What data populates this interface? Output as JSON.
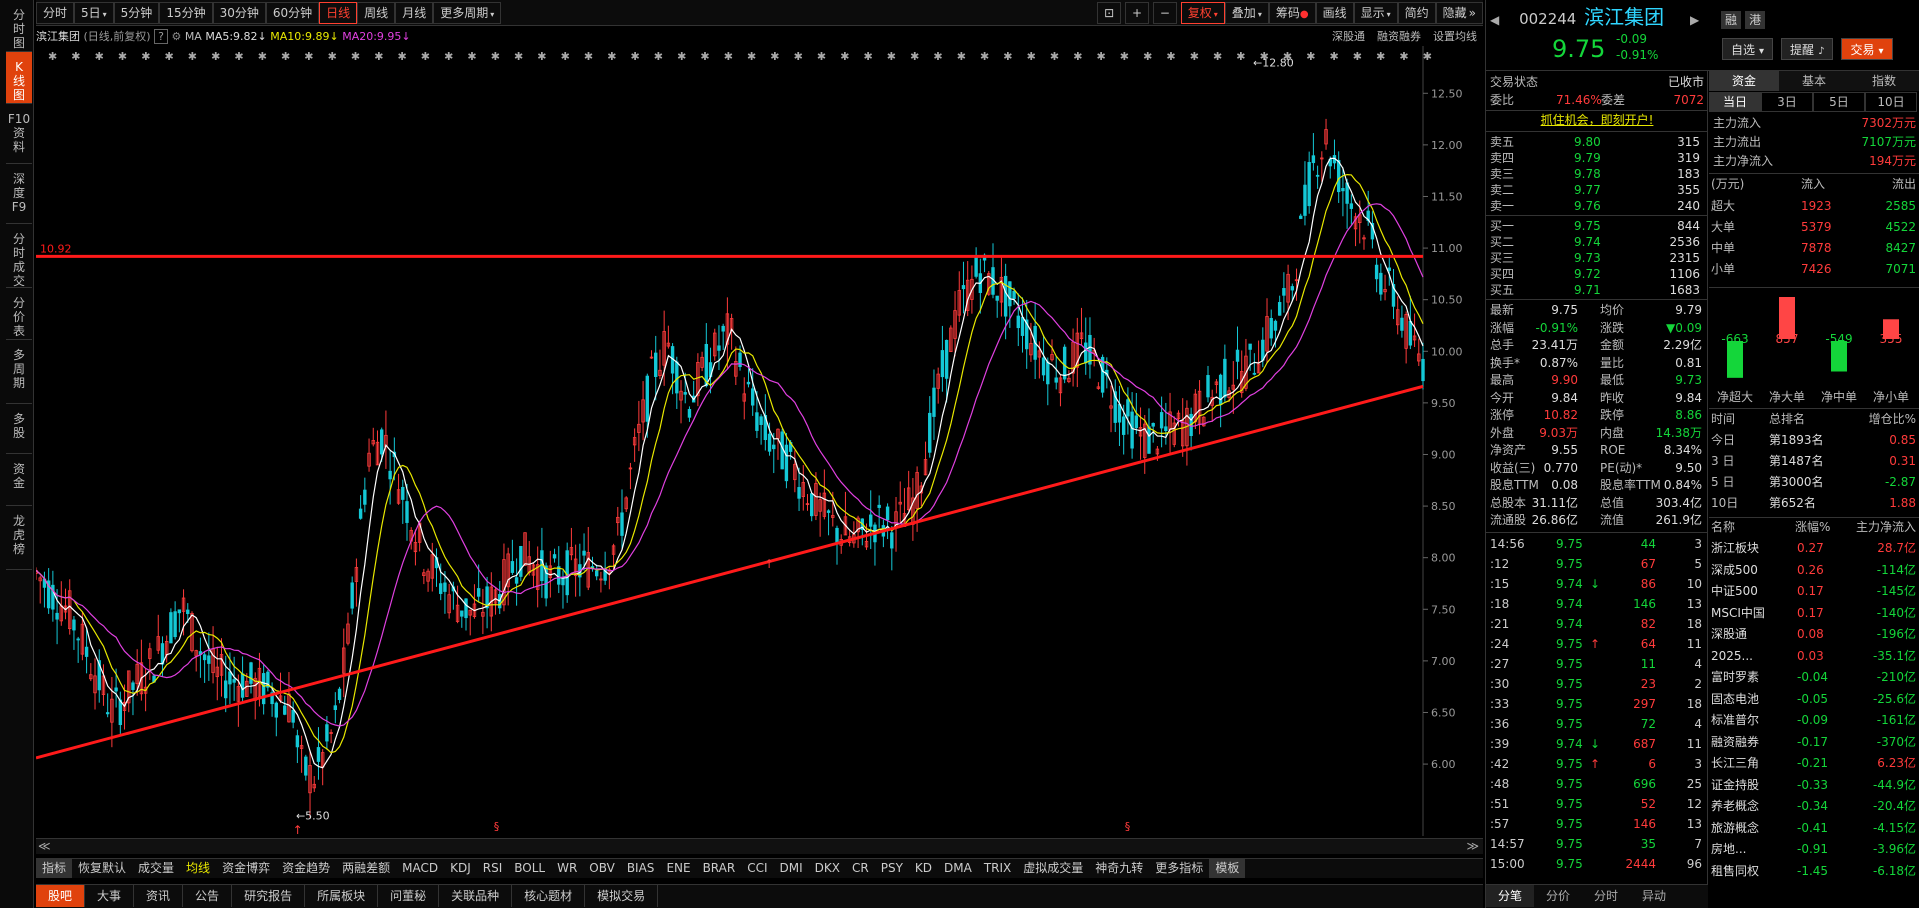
{
  "left_tabs": [
    {
      "label": "分\n时\n图",
      "active": false
    },
    {
      "label": "K\n线\n图",
      "active": true
    },
    {
      "label": "F10\n资\n料",
      "active": false
    },
    {
      "label": "深\n度\nF9",
      "active": false
    },
    {
      "label": "分\n时\n成\n交",
      "active": false
    },
    {
      "label": "分\n价\n表",
      "active": false
    },
    {
      "label": "多\n周\n期",
      "active": false
    },
    {
      "label": "多\n股",
      "active": false
    },
    {
      "label": "资\n金",
      "active": false
    },
    {
      "label": "龙\n虎\n榜",
      "active": false
    }
  ],
  "toolbar": {
    "periods": [
      "分时",
      "5日",
      "5分钟",
      "15分钟",
      "30分钟",
      "60分钟",
      "日线",
      "周线",
      "月线",
      "更多周期"
    ],
    "active_period": "日线",
    "right_buttons": [
      "复权",
      "叠加",
      "筹码",
      "画线",
      "显示",
      "简约",
      "隐藏"
    ],
    "active_right": "复权"
  },
  "info": {
    "name": "滨江集团",
    "mode": "(日线,前复权)",
    "help": "?",
    "ma_label": "MA",
    "ma5": "MA5:9.82",
    "ma10": "MA10:9.89",
    "ma20": "MA20:9.95",
    "right_links": [
      "深股通",
      "融资融券",
      "设置均线"
    ]
  },
  "colors": {
    "ma5": "#ffffff",
    "ma10": "#e8e800",
    "ma20": "#e040e0",
    "up": "#ff3b3b",
    "down": "#14c8d6",
    "line": "#ff1a1a"
  },
  "chart_data": {
    "type": "candlestick",
    "y_ticks": [
      "12.50",
      "12.00",
      "11.50",
      "11.00",
      "10.50",
      "10.00",
      "9.50",
      "9.00",
      "8.50",
      "8.00",
      "7.50",
      "7.00",
      "6.50",
      "6.00"
    ],
    "ylim": [
      5.4,
      12.9
    ],
    "hline": {
      "value": 10.92,
      "label": "10.92"
    },
    "trendline": {
      "from": [
        0,
        6.06
      ],
      "to": [
        1,
        9.66
      ]
    },
    "annotations": [
      {
        "text": "12.80",
        "x": 0.876,
        "y": 12.8
      },
      {
        "text": "5.50",
        "x": 0.186,
        "y": 5.5
      }
    ],
    "markers": [
      "§",
      "§"
    ],
    "keypoints": [
      [
        0.0,
        7.85
      ],
      [
        0.025,
        7.45
      ],
      [
        0.055,
        6.5
      ],
      [
        0.07,
        6.75
      ],
      [
        0.085,
        7.0
      ],
      [
        0.105,
        7.55
      ],
      [
        0.115,
        7.2
      ],
      [
        0.13,
        6.85
      ],
      [
        0.15,
        6.8
      ],
      [
        0.17,
        6.7
      ],
      [
        0.185,
        6.55
      ],
      [
        0.19,
        6.0
      ],
      [
        0.2,
        5.85
      ],
      [
        0.215,
        6.35
      ],
      [
        0.225,
        7.2
      ],
      [
        0.232,
        8.1
      ],
      [
        0.24,
        9.0
      ],
      [
        0.25,
        9.2
      ],
      [
        0.265,
        8.6
      ],
      [
        0.28,
        8.0
      ],
      [
        0.3,
        7.6
      ],
      [
        0.315,
        7.45
      ],
      [
        0.33,
        7.6
      ],
      [
        0.35,
        8.05
      ],
      [
        0.37,
        7.8
      ],
      [
        0.39,
        7.9
      ],
      [
        0.41,
        7.95
      ],
      [
        0.42,
        8.2
      ],
      [
        0.43,
        8.9
      ],
      [
        0.445,
        9.8
      ],
      [
        0.455,
        10.1
      ],
      [
        0.47,
        9.5
      ],
      [
        0.485,
        9.9
      ],
      [
        0.5,
        10.2
      ],
      [
        0.51,
        9.7
      ],
      [
        0.525,
        9.2
      ],
      [
        0.545,
        8.9
      ],
      [
        0.56,
        8.55
      ],
      [
        0.575,
        8.3
      ],
      [
        0.59,
        8.15
      ],
      [
        0.605,
        8.35
      ],
      [
        0.62,
        8.3
      ],
      [
        0.635,
        8.6
      ],
      [
        0.65,
        9.6
      ],
      [
        0.665,
        10.4
      ],
      [
        0.68,
        10.8
      ],
      [
        0.695,
        10.6
      ],
      [
        0.71,
        10.3
      ],
      [
        0.725,
        9.95
      ],
      [
        0.74,
        9.8
      ],
      [
        0.755,
        10.05
      ],
      [
        0.77,
        9.75
      ],
      [
        0.785,
        9.35
      ],
      [
        0.8,
        9.15
      ],
      [
        0.815,
        9.2
      ],
      [
        0.83,
        9.3
      ],
      [
        0.845,
        9.55
      ],
      [
        0.86,
        9.75
      ],
      [
        0.875,
        9.85
      ],
      [
        0.89,
        10.2
      ],
      [
        0.905,
        10.6
      ],
      [
        0.92,
        11.8
      ],
      [
        0.93,
        12.05
      ],
      [
        0.945,
        11.5
      ],
      [
        0.96,
        11.2
      ],
      [
        0.97,
        10.7
      ],
      [
        0.98,
        10.5
      ],
      [
        0.99,
        10.1
      ],
      [
        1.0,
        9.9
      ]
    ]
  },
  "bottom_scroll": {
    "left": "≪",
    "right": "≫"
  },
  "indicators": [
    "指标",
    "恢复默认",
    "成交量",
    "均线",
    "资金博弈",
    "资金趋势",
    "两融差额",
    "MACD",
    "KDJ",
    "RSI",
    "BOLL",
    "WR",
    "OBV",
    "BIAS",
    "ENE",
    "BRAR",
    "CCI",
    "DMI",
    "DKX",
    "CR",
    "PSY",
    "KD",
    "DMA",
    "TRIX",
    "虚拟成交量",
    "神奇九转",
    "更多指标",
    "模板"
  ],
  "active_indicator": "均线",
  "bottom_tabs": [
    "股吧",
    "大事",
    "资讯",
    "公告",
    "研究报告",
    "所属板块",
    "问董秘",
    "关联品种",
    "核心题材",
    "模拟交易"
  ],
  "active_bottom": "股吧",
  "quote": {
    "code": "002244",
    "name": "滨江集团",
    "badges": [
      "融",
      "港"
    ],
    "price": "9.75",
    "change": "-0.09",
    "pct": "-0.91%",
    "buttons": [
      "自选",
      "提醒",
      "交易"
    ],
    "status_label": "交易状态",
    "status_value": "已收市",
    "weibi_label": "委比",
    "weibi": "71.46%",
    "weicha_label": "委差",
    "weicha": "7072",
    "promo": "抓住机会，即刻开户!",
    "sells": [
      [
        "卖五",
        "9.80",
        "315"
      ],
      [
        "卖四",
        "9.79",
        "319"
      ],
      [
        "卖三",
        "9.78",
        "183"
      ],
      [
        "卖二",
        "9.77",
        "355"
      ],
      [
        "卖一",
        "9.76",
        "240"
      ]
    ],
    "buys": [
      [
        "买一",
        "9.75",
        "844"
      ],
      [
        "买二",
        "9.74",
        "2536"
      ],
      [
        "买三",
        "9.73",
        "2315"
      ],
      [
        "买四",
        "9.72",
        "1106"
      ],
      [
        "买五",
        "9.71",
        "1683"
      ]
    ],
    "stats": [
      [
        "最新",
        "9.75",
        "均价",
        "9.79"
      ],
      [
        "涨幅",
        "-0.91%",
        "涨跌",
        "▼0.09"
      ],
      [
        "总手",
        "23.41万",
        "金额",
        "2.29亿"
      ],
      [
        "换手*",
        "0.87%",
        "量比",
        "0.81"
      ],
      [
        "最高",
        "9.90",
        "最低",
        "9.73"
      ],
      [
        "今开",
        "9.84",
        "昨收",
        "9.84"
      ],
      [
        "涨停",
        "10.82",
        "跌停",
        "8.86"
      ],
      [
        "外盘",
        "9.03万",
        "内盘",
        "14.38万"
      ],
      [
        "净资产",
        "9.55",
        "ROE",
        "8.34%"
      ],
      [
        "收益(三)",
        "0.770",
        "PE(动)*",
        "9.50"
      ],
      [
        "股息TTM",
        "0.08",
        "股息率TTM",
        "0.84%"
      ],
      [
        "总股本",
        "31.11亿",
        "总值",
        "303.4亿"
      ],
      [
        "流通股",
        "26.86亿",
        "流值",
        "261.9亿"
      ]
    ],
    "ticks": [
      [
        "14:56",
        "9.75",
        "44",
        "3",
        ""
      ],
      [
        ":12",
        "9.75",
        "67",
        "5",
        ""
      ],
      [
        ":15",
        "9.74",
        "86",
        "10",
        "↓"
      ],
      [
        ":18",
        "9.74",
        "146",
        "13",
        ""
      ],
      [
        ":21",
        "9.74",
        "82",
        "18",
        ""
      ],
      [
        ":24",
        "9.75",
        "64",
        "11",
        "↑"
      ],
      [
        ":27",
        "9.75",
        "11",
        "4",
        ""
      ],
      [
        ":30",
        "9.75",
        "23",
        "2",
        ""
      ],
      [
        ":33",
        "9.75",
        "297",
        "18",
        ""
      ],
      [
        ":36",
        "9.75",
        "72",
        "4",
        ""
      ],
      [
        ":39",
        "9.74",
        "687",
        "11",
        "↓"
      ],
      [
        ":42",
        "9.75",
        "6",
        "3",
        "↑"
      ],
      [
        ":48",
        "9.75",
        "696",
        "25",
        ""
      ],
      [
        ":51",
        "9.75",
        "52",
        "12",
        ""
      ],
      [
        ":57",
        "9.75",
        "146",
        "13",
        ""
      ],
      [
        "14:57",
        "9.75",
        "35",
        "7",
        ""
      ],
      [
        "15:00",
        "9.75",
        "2444",
        "96",
        ""
      ]
    ],
    "tick_tabs": [
      "分笔",
      "分价",
      "分时",
      "异动"
    ]
  },
  "fund": {
    "tabs": [
      "资金",
      "基本",
      "指数"
    ],
    "periods": [
      "当日",
      "3日",
      "5日",
      "10日"
    ],
    "flows": [
      [
        "主力流入",
        "7302万元"
      ],
      [
        "主力流出",
        "7107万元"
      ],
      [
        "主力净流入",
        "194万元"
      ]
    ],
    "table_head": [
      "(万元)",
      "流入",
      "流出"
    ],
    "table": [
      [
        "超大",
        "1923",
        "2585"
      ],
      [
        "大单",
        "5379",
        "4522"
      ],
      [
        "中单",
        "7878",
        "8427"
      ],
      [
        "小单",
        "7426",
        "7071"
      ]
    ],
    "bars": [
      {
        "label": "净超大",
        "value": -663
      },
      {
        "label": "净大单",
        "value": 857
      },
      {
        "label": "净中单",
        "value": -549
      },
      {
        "label": "净小单",
        "value": 355
      }
    ],
    "rank_head": [
      "时间",
      "总排名",
      "增仓比%"
    ],
    "ranks": [
      [
        "今日",
        "第1893名",
        "0.85"
      ],
      [
        "3 日",
        "第1487名",
        "0.31"
      ],
      [
        "5 日",
        "第3000名",
        "-2.87"
      ],
      [
        "10日",
        "第652名",
        "1.88"
      ]
    ],
    "sector_head": [
      "名称",
      "涨幅%",
      "主力净流入"
    ],
    "sectors": [
      [
        "浙江板块",
        "0.27",
        "28.7亿"
      ],
      [
        "深成500",
        "0.26",
        "-114亿"
      ],
      [
        "中证500",
        "0.17",
        "-145亿"
      ],
      [
        "MSCI中国",
        "0.17",
        "-140亿"
      ],
      [
        "深股通",
        "0.08",
        "-196亿"
      ],
      [
        "2025...",
        "0.03",
        "-35.1亿"
      ],
      [
        "富时罗素",
        "-0.04",
        "-210亿"
      ],
      [
        "固态电池",
        "-0.05",
        "-25.6亿"
      ],
      [
        "标准普尔",
        "-0.09",
        "-161亿"
      ],
      [
        "融资融券",
        "-0.17",
        "-370亿"
      ],
      [
        "长江三角",
        "-0.21",
        "6.23亿"
      ],
      [
        "证金持股",
        "-0.33",
        "-44.9亿"
      ],
      [
        "养老概念",
        "-0.34",
        "-20.4亿"
      ],
      [
        "旅游概念",
        "-0.41",
        "-4.15亿"
      ],
      [
        "房地...",
        "-0.91",
        "-3.96亿"
      ],
      [
        "租售同权",
        "-1.45",
        "-6.18亿"
      ]
    ]
  }
}
